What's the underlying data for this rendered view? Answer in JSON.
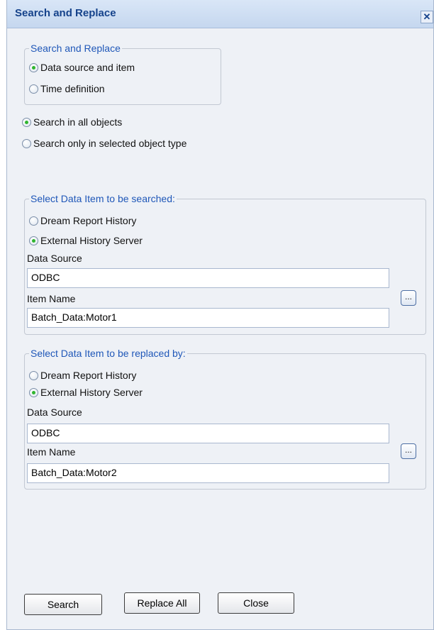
{
  "window": {
    "title": "Search and Replace",
    "close_icon": "close-icon"
  },
  "mode_group": {
    "legend": "Search and Replace",
    "options": [
      "Data source and item",
      "Time definition"
    ],
    "selected": "Data source and item"
  },
  "scope": {
    "options": [
      "Search in all objects",
      "Search only in selected object type"
    ],
    "selected": "Search in all objects"
  },
  "search_group": {
    "legend": "Select Data Item to be searched:",
    "options": [
      "Dream Report History",
      "External History Server"
    ],
    "selected": "External History Server",
    "data_source_label": "Data Source",
    "data_source_value": "ODBC",
    "item_name_label": "Item Name",
    "item_name_value": "Batch_Data:Motor1",
    "browse_label": "..."
  },
  "replace_group": {
    "legend": "Select Data Item to be replaced by:",
    "options": [
      "Dream Report History",
      "External History Server"
    ],
    "selected": "External History Server",
    "data_source_label": "Data Source",
    "data_source_value": "ODBC",
    "item_name_label": "Item Name",
    "item_name_value": "Batch_Data:Motor2",
    "browse_label": "..."
  },
  "buttons": {
    "search": "Search",
    "replace_all": "Replace All",
    "close": "Close"
  },
  "colors": {
    "title": "#15428b",
    "legend": "#1f57b8",
    "radio_dot": "#2fb52f",
    "dialog_bg": "#eef1f6"
  }
}
